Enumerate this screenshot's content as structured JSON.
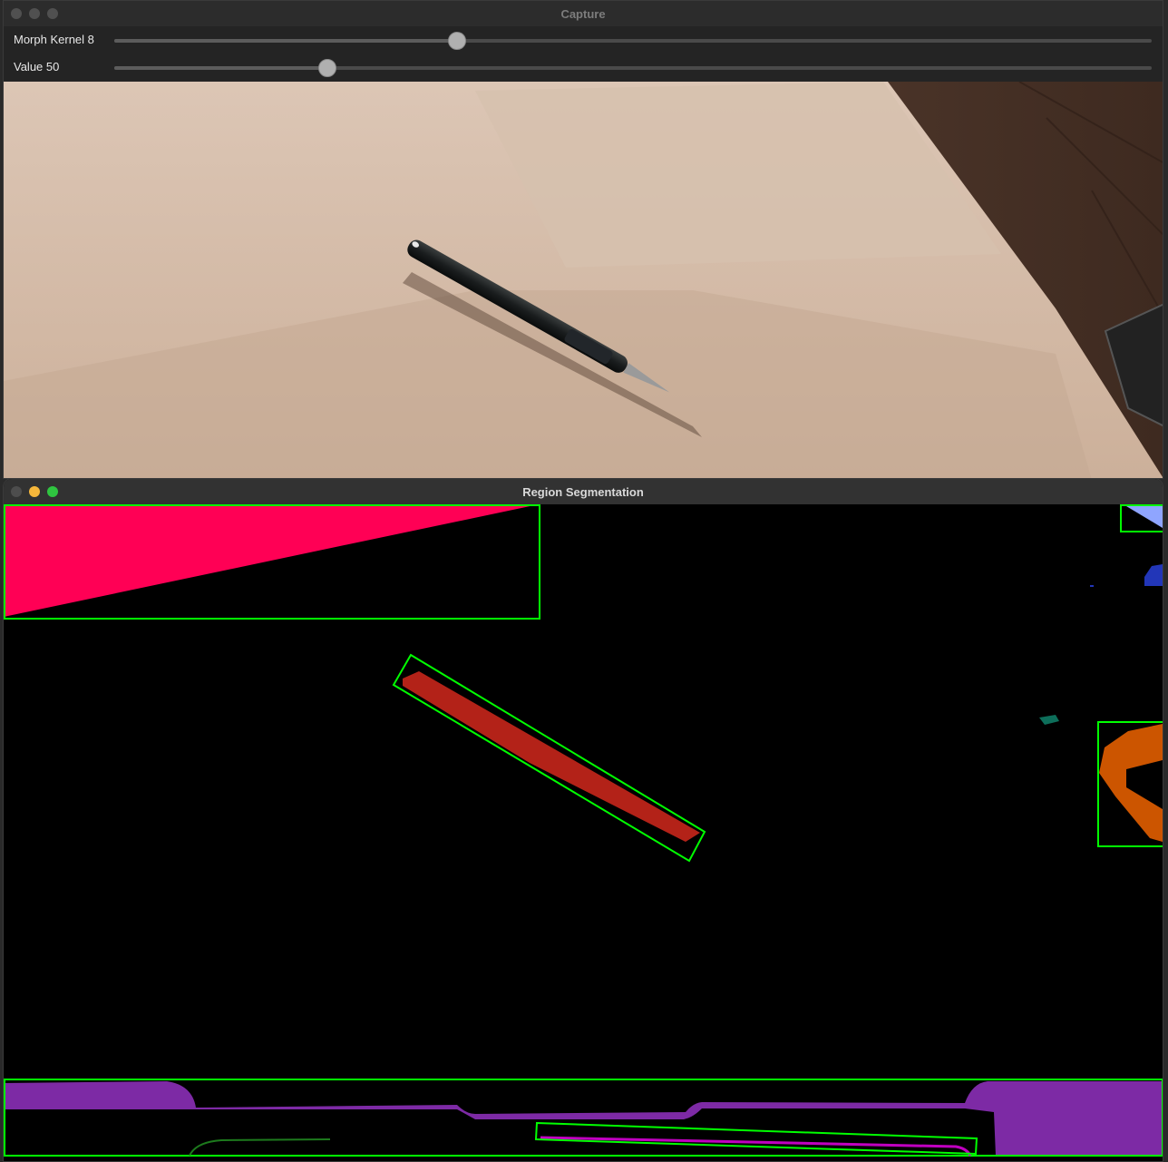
{
  "capture_window": {
    "title": "Capture",
    "trackbars": [
      {
        "label": "Morph Kernel 8",
        "value": 8,
        "position_fraction": 0.33
      },
      {
        "label": "Value 50",
        "value": 50,
        "position_fraction": 0.205
      }
    ],
    "video_frame": {
      "subject": "pen-on-paper"
    }
  },
  "segmentation_window": {
    "title": "Region Segmentation",
    "bounding_box_color": "#00ff00",
    "region_colors": {
      "pink": "#ff0055",
      "red": "#b32218",
      "orange": "#cc5500",
      "purple": "#7d2aa5",
      "magenta": "#c000c0",
      "lavender": "#8fa5ff",
      "blue": "#2236b8",
      "teal": "#0d6e5a",
      "dark_green": "#1d7a1d"
    }
  }
}
